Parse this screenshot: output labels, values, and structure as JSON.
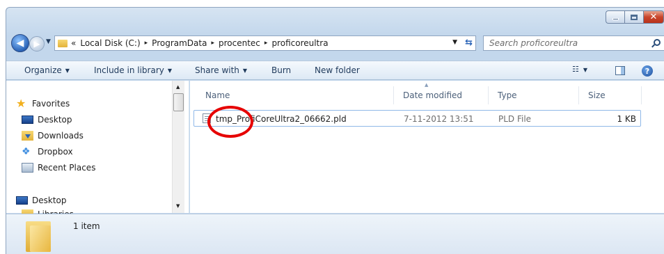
{
  "window": {
    "caption_buttons": {
      "minimize": "",
      "maximize": "",
      "close": "✕"
    }
  },
  "navigation": {
    "back_glyph": "◀",
    "forward_glyph": "▶",
    "breadcrumbs": [
      "«",
      "Local Disk (C:)",
      "ProgramData",
      "procentec",
      "proficoreultra"
    ],
    "separator": "▸",
    "refresh_glyph": "⇆"
  },
  "search": {
    "placeholder": "Search proficoreultra"
  },
  "command_bar": {
    "organize": "Organize",
    "include_in_library": "Include in library",
    "share_with": "Share with",
    "burn": "Burn",
    "new_folder": "New folder",
    "help": "?"
  },
  "nav_pane": {
    "items": [
      {
        "label": "Favorites",
        "icon": "star-icon"
      },
      {
        "label": "Desktop",
        "icon": "desktop-icon"
      },
      {
        "label": "Downloads",
        "icon": "downloads-icon"
      },
      {
        "label": "Dropbox",
        "icon": "dropbox-icon"
      },
      {
        "label": "Recent Places",
        "icon": "recent-places-icon"
      },
      {
        "label": "Desktop",
        "icon": "desktop-icon"
      },
      {
        "label": "Libraries",
        "icon": "libraries-icon"
      }
    ]
  },
  "file_list": {
    "columns": [
      "Name",
      "Date modified",
      "Type",
      "Size"
    ],
    "rows": [
      {
        "name": "tmp_ProfiCoreUltra2_06662.pld",
        "date_modified": "7-11-2012 13:51",
        "type": "PLD File",
        "size": "1 KB"
      }
    ]
  },
  "details": {
    "item_count": "1 item"
  },
  "colors": {
    "highlight_circle": "#e60000",
    "accent": "#2a63b7"
  }
}
